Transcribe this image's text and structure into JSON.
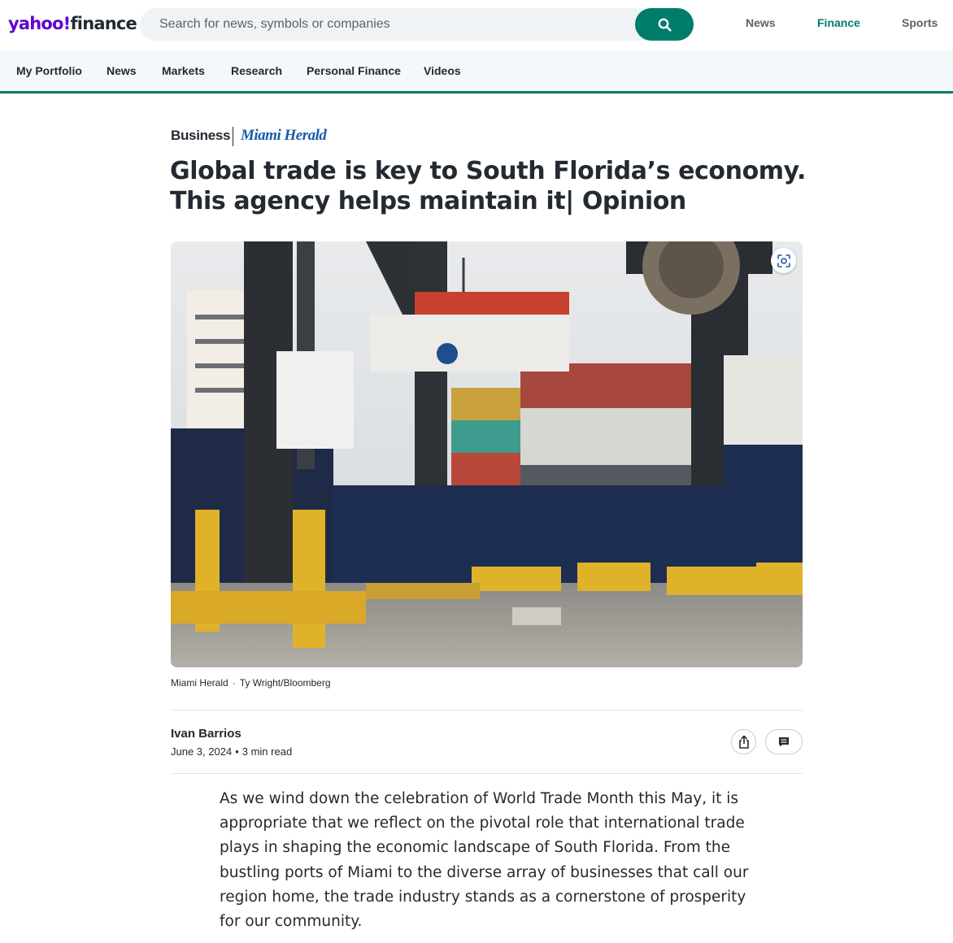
{
  "header": {
    "logo_part1": "yahoo!",
    "logo_part2": "finance",
    "search_placeholder": "Search for news, symbols or companies",
    "nav": [
      {
        "label": "News"
      },
      {
        "label": "Finance",
        "active": true
      },
      {
        "label": "Sports"
      }
    ]
  },
  "subnav": {
    "items": [
      {
        "label": "My Portfolio"
      },
      {
        "label": "News"
      },
      {
        "label": "Markets"
      },
      {
        "label": "Research"
      },
      {
        "label": "Personal Finance"
      },
      {
        "label": "Videos"
      }
    ]
  },
  "article": {
    "category": "Business",
    "publisher": "Miami Herald",
    "headline": "Global trade is key to South Florida’s economy. This agency helps maintain it| Opinion",
    "caption_source": "Miami Herald",
    "caption_credit": "Ty Wright/Bloomberg",
    "author": "Ivan Barrios",
    "date": "June 3, 2024",
    "read_time": "3 min read",
    "body": "As we wind down the celebration of World Trade Month this May, it is appropriate that we reflect on the pivotal role that international trade plays in shaping the economic landscape of South Florida. From the bustling ports of Miami to the diverse array of businesses that call our region home, the trade industry stands as a cornerstone of prosperity for our community."
  },
  "colors": {
    "brand_purple": "#6001d2",
    "finance_green": "#007c6b",
    "text_dark": "#232a31",
    "publisher_blue": "#1a5ba8"
  },
  "icons": {
    "search": "search-icon",
    "zoom": "image-zoom-icon",
    "share": "share-icon",
    "comment": "comment-icon"
  }
}
